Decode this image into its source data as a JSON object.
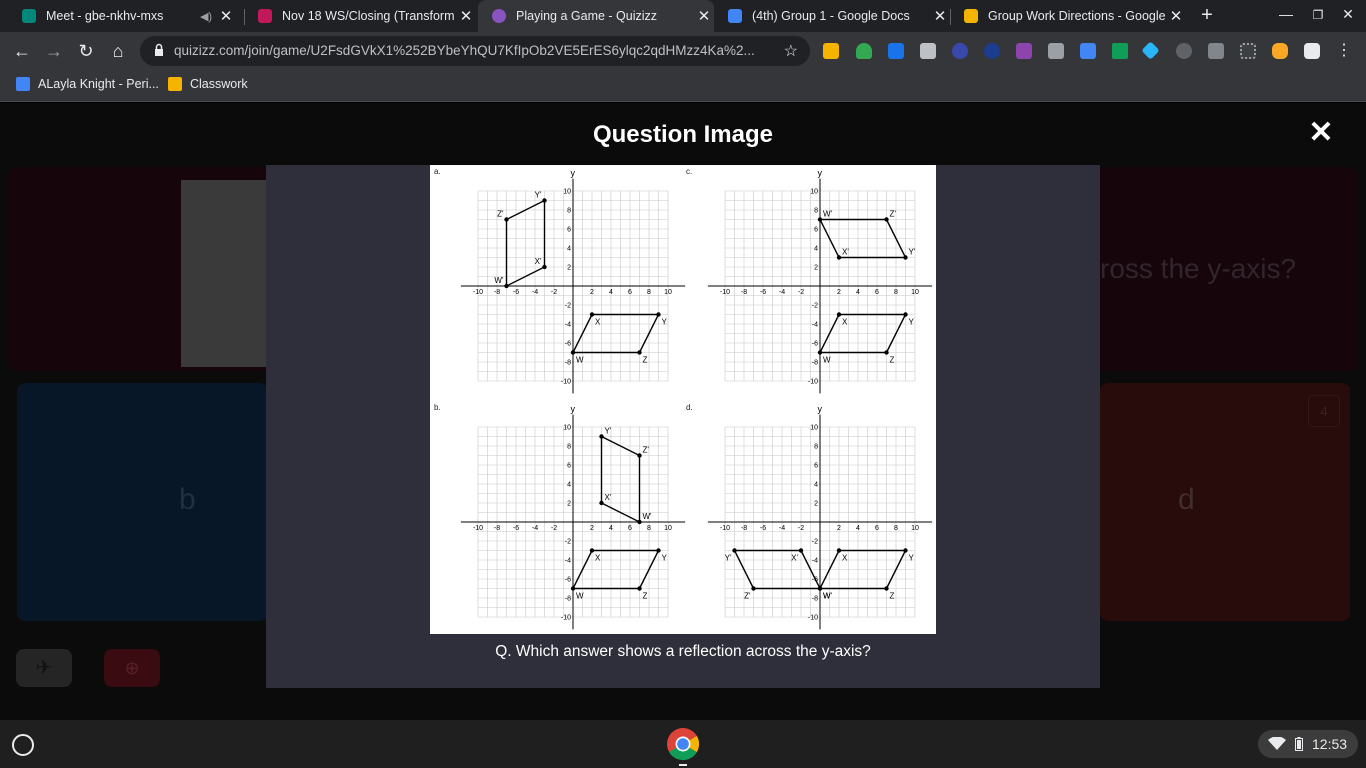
{
  "browser": {
    "tabs": [
      {
        "title": "Meet - gbe-nkhv-mxs",
        "favicon_color": "#00897b",
        "active": false
      },
      {
        "title": "Nov 18 WS/Closing (Transform",
        "favicon_color": "#c2185b",
        "active": false
      },
      {
        "title": "Playing a Game - Quizizz",
        "favicon_color": "#8854c0",
        "active": true
      },
      {
        "title": "(4th) Group 1 - Google Docs",
        "favicon_color": "#4285f4",
        "active": false
      },
      {
        "title": "Group Work Directions - Google",
        "favicon_color": "#f4b400",
        "active": false
      }
    ],
    "new_tab_label": "+",
    "url": "quizizz.com/join/game/U2FsdGVkX1%252BYbeYhQU7KfIpOb2VE5ErES6ylqc2qdHMzz4Ka%2...",
    "bookmarks": [
      {
        "label": "ALayla Knight - Peri...",
        "icon_color": "#4285f4"
      },
      {
        "label": "Classwork",
        "icon_color": "#f4b400"
      }
    ]
  },
  "modal": {
    "title": "Question Image",
    "close_label": "✕",
    "question": "Q. Which answer shows a reflection across the y-axis?"
  },
  "background": {
    "question_fragment": "ross the y-axis?",
    "option_b": "b",
    "option_d": "d",
    "option_d_number": "4"
  },
  "graph": {
    "panel_labels": [
      "a.",
      "b.",
      "c.",
      "d."
    ],
    "axis_x_name": "y",
    "x_ticks": [
      "-10",
      "-8",
      "-6",
      "-4",
      "-2",
      "2",
      "4",
      "6",
      "8",
      "10"
    ],
    "y_ticks": [
      "10",
      "8",
      "6",
      "4",
      "2",
      "-2",
      "-4",
      "-6",
      "-8",
      "-10"
    ],
    "original": {
      "points": [
        [
          "X",
          2,
          -3
        ],
        [
          "Y",
          9,
          -3
        ],
        [
          "Z",
          7,
          -7
        ],
        [
          "W",
          0,
          -7
        ]
      ]
    },
    "images": [
      {
        "panel": "a",
        "points": [
          [
            "Y'",
            -3,
            9
          ],
          [
            "X'",
            -3,
            2
          ],
          [
            "W'",
            -7,
            0
          ],
          [
            "Z'",
            -7,
            7
          ]
        ]
      },
      {
        "panel": "b",
        "points": [
          [
            "Y'",
            3,
            9
          ],
          [
            "Z'",
            7,
            7
          ],
          [
            "W'",
            7,
            0
          ],
          [
            "X'",
            3,
            2
          ]
        ]
      },
      {
        "panel": "c",
        "points": [
          [
            "W'",
            0,
            7
          ],
          [
            "Z'",
            7,
            7
          ],
          [
            "Y'",
            9,
            3
          ],
          [
            "X'",
            2,
            3
          ]
        ]
      },
      {
        "panel": "d",
        "points": [
          [
            "Y'",
            -9,
            -3
          ],
          [
            "X'",
            -2,
            -3
          ],
          [
            "W'",
            0,
            -7
          ],
          [
            "Z'",
            -7,
            -7
          ]
        ]
      }
    ]
  },
  "taskbar": {
    "clock": "12:53"
  }
}
